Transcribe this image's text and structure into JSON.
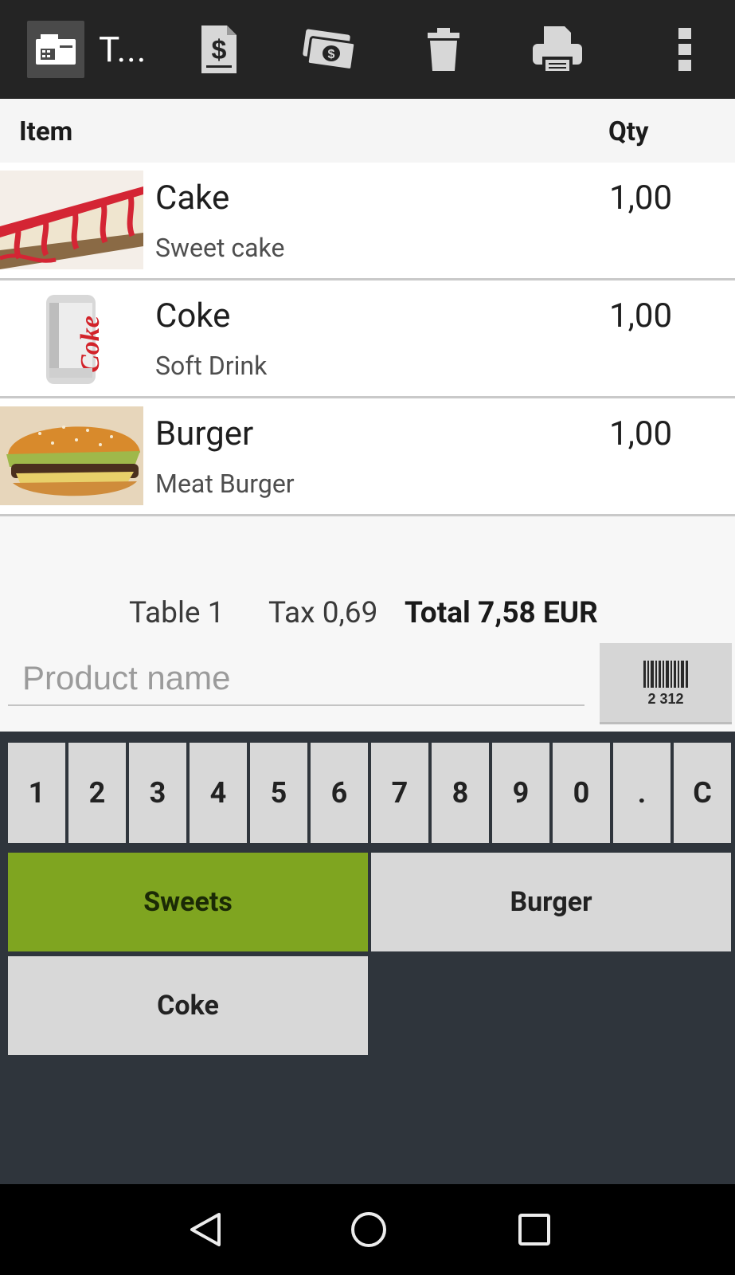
{
  "toolbar": {
    "register_title": "T...",
    "icons": [
      "cash-register-icon",
      "bill-icon",
      "money-icon",
      "trash-icon",
      "printer-icon",
      "overflow-menu-icon"
    ]
  },
  "header": {
    "item": "Item",
    "qty": "Qty"
  },
  "items": [
    {
      "name": "Cake",
      "description": "Sweet cake",
      "qty": "1,00"
    },
    {
      "name": "Coke",
      "description": "Soft Drink",
      "qty": "1,00"
    },
    {
      "name": "Burger",
      "description": "Meat Burger",
      "qty": "1,00"
    }
  ],
  "totals": {
    "table": "Table 1",
    "tax": "Tax  0,69",
    "total": "Total  7,58 EUR"
  },
  "search": {
    "placeholder": "Product name",
    "barcode_digits": "2 312"
  },
  "keypad": [
    "1",
    "2",
    "3",
    "4",
    "5",
    "6",
    "7",
    "8",
    "9",
    "0",
    ".",
    "C"
  ],
  "categories": [
    {
      "label": "Sweets",
      "active": true
    },
    {
      "label": "Burger",
      "active": false
    },
    {
      "label": "Coke",
      "active": false
    }
  ],
  "colors": {
    "accent": "#7fa520",
    "toolbar": "#242424",
    "panel": "#2f353c"
  }
}
